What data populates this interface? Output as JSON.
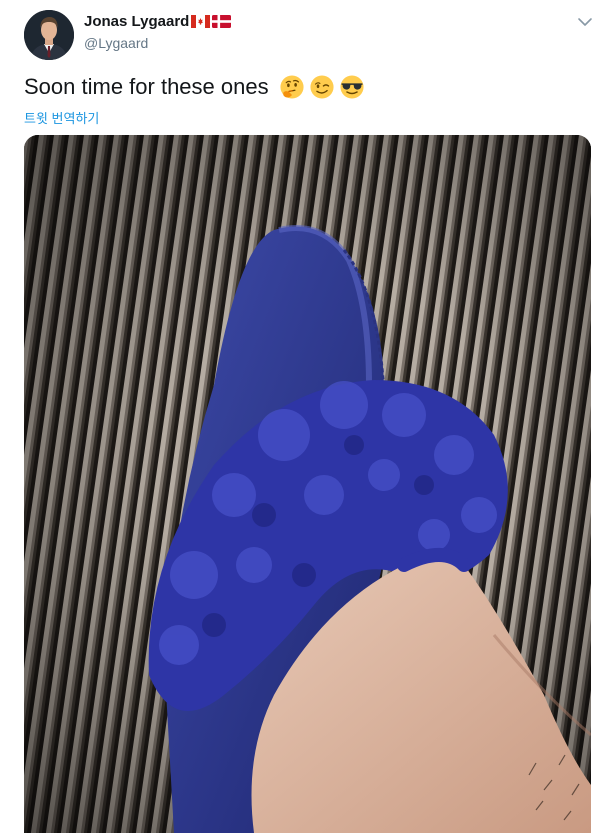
{
  "author": {
    "display_name": "Jonas Lygaard",
    "handle": "@Lygaard",
    "flags": [
      "canada-flag-icon",
      "denmark-flag-icon"
    ]
  },
  "tweet": {
    "text": "Soon time for these ones",
    "emojis": [
      "thinking-face-icon",
      "winking-face-icon",
      "sunglasses-face-icon"
    ],
    "translate_label": "트윗 번역하기"
  },
  "media": {
    "image_subject": "blue-fur-slipper-photo"
  },
  "colors": {
    "name": "#14171a",
    "handle": "#657786",
    "link": "#1b95e0",
    "slipper": "#2f3aa8",
    "emoji": "#ffcc4d"
  }
}
